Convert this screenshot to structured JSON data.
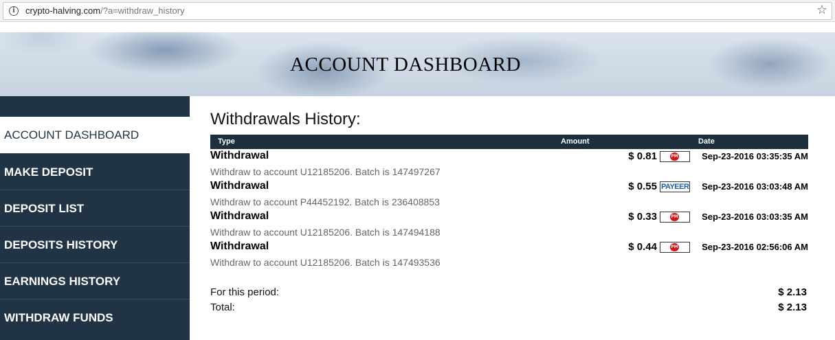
{
  "browser": {
    "url_host": "crypto-halving.com",
    "url_path": "/?a=withdraw_history"
  },
  "banner": {
    "title": "ACCOUNT DASHBOARD"
  },
  "sidebar": {
    "items": [
      {
        "label": "ACCOUNT DASHBOARD",
        "active": true
      },
      {
        "label": "MAKE DEPOSIT"
      },
      {
        "label": "DEPOSIT LIST"
      },
      {
        "label": "DEPOSITS HISTORY"
      },
      {
        "label": "EARNINGS HISTORY"
      },
      {
        "label": "WITHDRAW FUNDS"
      }
    ]
  },
  "main": {
    "title": "Withdrawals History:",
    "columns": {
      "type": "Type",
      "amount": "Amount",
      "date": "Date"
    },
    "rows": [
      {
        "type": "Withdrawal",
        "amount": "$ 0.81",
        "method": "PM",
        "date": "Sep-23-2016 03:35:35 AM",
        "description": "Withdraw to account U12185206. Batch is 147497267"
      },
      {
        "type": "Withdrawal",
        "amount": "$ 0.55",
        "method": "PAYEER",
        "date": "Sep-23-2016 03:03:48 AM",
        "description": "Withdraw to account P44452192. Batch is 236408853"
      },
      {
        "type": "Withdrawal",
        "amount": "$ 0.33",
        "method": "PM",
        "date": "Sep-23-2016 03:03:35 AM",
        "description": "Withdraw to account U12185206. Batch is 147494188"
      },
      {
        "type": "Withdrawal",
        "amount": "$ 0.44",
        "method": "PM",
        "date": "Sep-23-2016 02:56:06 AM",
        "description": "Withdraw to account U12185206. Batch is 147493536"
      }
    ],
    "summary": {
      "period_label": "For this period:",
      "period_value": "$ 2.13",
      "total_label": "Total:",
      "total_value": "$ 2.13"
    }
  },
  "colors": {
    "sidebar_bg": "#213446",
    "table_header_bg": "#1b2f3c",
    "pm_red": "#e01010",
    "payeer_blue": "#1a5fa8"
  }
}
